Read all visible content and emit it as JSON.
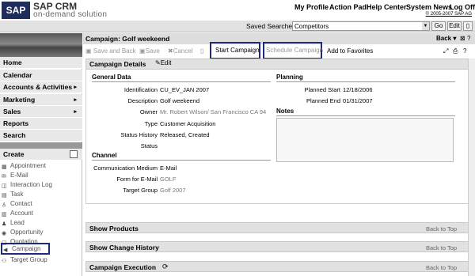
{
  "header": {
    "logo": "SAP",
    "app_name": "SAP CRM",
    "app_sub": "on-demand solution",
    "links": [
      "My Profile",
      "Action Pad",
      "Help Center",
      "System News",
      "Log Off"
    ],
    "copyright": "© 2005-2007 SAP AG"
  },
  "search": {
    "label": "Saved Searches",
    "selected": "Competitors",
    "go": "Go",
    "edit": "Edit"
  },
  "nav": {
    "items": [
      {
        "label": "Home",
        "arrow": ""
      },
      {
        "label": "Calendar",
        "arrow": ""
      },
      {
        "label": "Accounts & Activities",
        "arrow": "▸"
      },
      {
        "label": "Marketing",
        "arrow": "▸"
      },
      {
        "label": "Sales",
        "arrow": "▸"
      },
      {
        "label": "Reports",
        "arrow": ""
      },
      {
        "label": "Search",
        "arrow": ""
      }
    ],
    "create_label": "Create",
    "create_items": [
      "Appointment",
      "E-Mail",
      "Interaction Log",
      "Task",
      "Contact",
      "Account",
      "Lead",
      "Opportunity",
      "Quotation",
      "Campaign",
      "Target Group"
    ]
  },
  "page": {
    "title": "Campaign: Golf weekeend",
    "back": "Back"
  },
  "toolbar": {
    "save_and_back": "Save and Back",
    "save": "Save",
    "cancel": "Cancel",
    "start_campaign": "Start Campaign",
    "schedule_campaign": "Schedule Campaign",
    "add_favorites": "Add to Favorites"
  },
  "details": {
    "title": "Campaign Details",
    "edit": "Edit",
    "general_data": "General Data",
    "planning": "Planning",
    "notes": "Notes",
    "channel": "Channel",
    "fields": {
      "identification": {
        "label": "Identification",
        "value": "CU_EV_JAN 2007"
      },
      "description": {
        "label": "Description",
        "value": "Golf weekeend"
      },
      "owner": {
        "label": "Owner",
        "value": "Mr. Robert Wilson/ San Francisco CA 94"
      },
      "type": {
        "label": "Type",
        "value": "Customer Acquisition"
      },
      "status_history": {
        "label": "Status History",
        "value": "Released, Created"
      },
      "status": {
        "label": "Status",
        "value": ""
      },
      "planned_start": {
        "label": "Planned Start",
        "value": "12/18/2006"
      },
      "planned_end": {
        "label": "Planned End",
        "value": "01/31/2007"
      },
      "comm_medium": {
        "label": "Communication Medium",
        "value": "E-Mail"
      },
      "form_email": {
        "label": "Form for E-Mail",
        "value": "GOLF"
      },
      "target_group": {
        "label": "Target Group",
        "value": "Golf 2007"
      }
    }
  },
  "sections": {
    "products": "Show Products",
    "change_history": "Show Change History",
    "execution": "Campaign Execution",
    "back_to_top": "Back to Top"
  }
}
